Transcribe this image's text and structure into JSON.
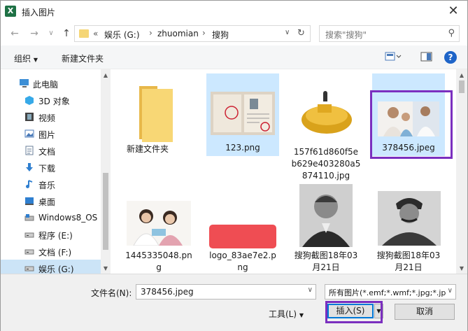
{
  "window": {
    "title": "插入图片",
    "close": "✕"
  },
  "nav": {
    "back": "←",
    "forward": "→",
    "recent": "∨",
    "up": "↑",
    "breadcrumb": [
      "«",
      "娱乐 (G:)",
      "zhuomian",
      "搜狗"
    ],
    "separator": "›",
    "search_placeholder": "搜索\"搜狗\""
  },
  "toolbar": {
    "organize": "组织",
    "new_folder": "新建文件夹",
    "help": "?"
  },
  "sidebar": {
    "items": [
      {
        "label": "此电脑",
        "icon": "computer-icon"
      },
      {
        "label": "3D 对象",
        "icon": "3d-objects-icon"
      },
      {
        "label": "视频",
        "icon": "video-icon"
      },
      {
        "label": "图片",
        "icon": "pictures-icon"
      },
      {
        "label": "文档",
        "icon": "documents-icon"
      },
      {
        "label": "下载",
        "icon": "download-icon"
      },
      {
        "label": "音乐",
        "icon": "music-icon"
      },
      {
        "label": "桌面",
        "icon": "desktop-icon"
      },
      {
        "label": "Windows8_OS",
        "icon": "drive-icon"
      },
      {
        "label": "程序 (E:)",
        "icon": "drive-icon"
      },
      {
        "label": "文档 (F:)",
        "icon": "drive-icon"
      },
      {
        "label": "娱乐 (G:)",
        "icon": "drive-icon",
        "selected": true
      }
    ]
  },
  "files": [
    {
      "name": "新建文件夹",
      "kind": "folder"
    },
    {
      "name": "123.png",
      "kind": "certificate"
    },
    {
      "name": "157f61d860f5e\nb629e403280a5\n874110.jpg",
      "kind": "gold"
    },
    {
      "name": "378456.jpeg",
      "kind": "family",
      "selected": true
    },
    {
      "name": "1445335048.pn\ng",
      "kind": "doctor"
    },
    {
      "name": "logo_83ae7e2.p\nng",
      "kind": "redlogo"
    },
    {
      "name": "搜狗截图18年03\n月21日",
      "kind": "portrait"
    },
    {
      "name": "搜狗截图18年03\n月21日",
      "kind": "portrait"
    }
  ],
  "bottom": {
    "filename_label": "文件名(N):",
    "filename_value": "378456.jpeg",
    "filter_value": "所有图片(*.emf;*.wmf;*.jpg;*.jp",
    "tools_label": "工具(L)",
    "insert_label": "插入(S)",
    "cancel_label": "取消"
  },
  "colors": {
    "selection": "#cce8ff",
    "accent": "#0078d7",
    "annotation": "#7b2fbf",
    "folder": "#f5d676"
  }
}
